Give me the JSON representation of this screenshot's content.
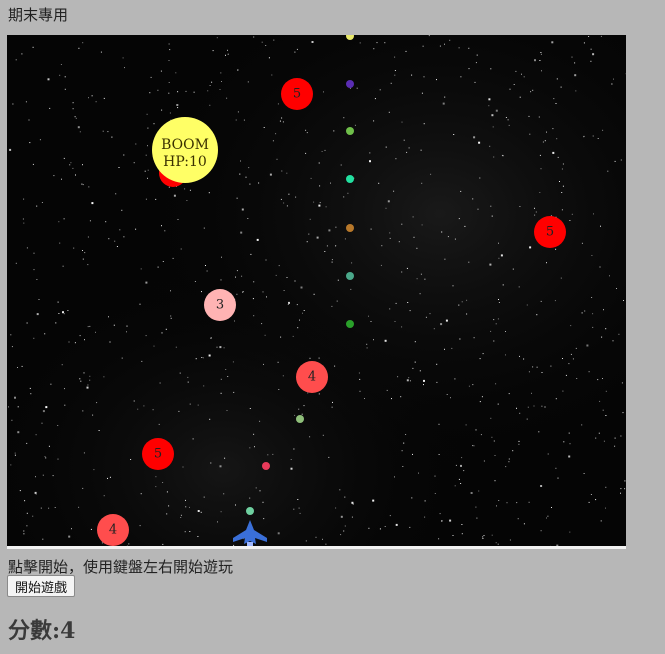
{
  "page": {
    "title": "期末專用",
    "instructions": "點擊開始，使用鍵盤左右開始遊玩",
    "start_button_label": "開始遊戲",
    "score_text": "分數:4"
  },
  "game": {
    "colors": {
      "background": "#050505",
      "enemy_hp5": "#ff0000",
      "enemy_hp4": "#ff4d4d",
      "enemy_hp3": "#ffb3b3",
      "boss": "#ffff66",
      "player": "#3a6fd8"
    },
    "boss": {
      "name": "BOOM",
      "hp_label": "HP:10"
    },
    "enemies": [
      {
        "label": "5",
        "hp": 5
      },
      {
        "label": "5",
        "hp": 5
      },
      {
        "label": "3",
        "hp": 3
      },
      {
        "label": "4",
        "hp": 4
      },
      {
        "label": "5",
        "hp": 5
      },
      {
        "label": "4",
        "hp": 4
      }
    ],
    "bullet_colors": [
      "#e8e86a",
      "#5a2db3",
      "#6fbf4a",
      "#22e0a0",
      "#b8782a",
      "#4aa88a",
      "#2aa02a",
      "#8fbf7a",
      "#e83a5a",
      "#6fd0a0"
    ],
    "player_icon": "spaceship-icon"
  }
}
